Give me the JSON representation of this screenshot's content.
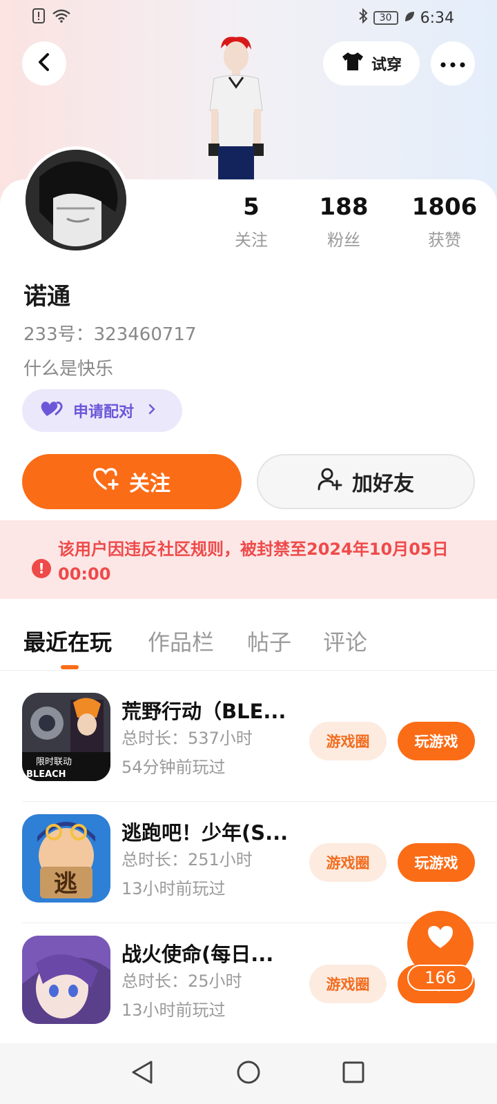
{
  "status_bar": {
    "time": "6:34",
    "battery": "30"
  },
  "header": {
    "try_on_label": "试穿"
  },
  "profile": {
    "stats": [
      {
        "value": "5",
        "label": "关注"
      },
      {
        "value": "188",
        "label": "粉丝"
      },
      {
        "value": "1806",
        "label": "获赞"
      }
    ],
    "username": "诺通",
    "user_id": "233号：323460717",
    "bio": "什么是快乐",
    "pair_label": "申请配对"
  },
  "actions": {
    "follow_label": "关注",
    "add_friend_label": "加好友"
  },
  "ban_notice": {
    "text": "该用户因违反社区规则，被封禁至2024年10月05日 00:00"
  },
  "tabs": [
    {
      "label": "最近在玩",
      "active": true
    },
    {
      "label": "作品栏",
      "active": false
    },
    {
      "label": "帖子",
      "active": false
    },
    {
      "label": "评论",
      "active": false
    }
  ],
  "games": [
    {
      "name": "荒野行动（BLE...",
      "duration": "总时长：537小时",
      "last_played": "54分钟前玩过",
      "circle_label": "游戏圈",
      "play_label": "玩游戏",
      "icon_text_1": "限时联动",
      "icon_text_2": "BLEACH"
    },
    {
      "name": "逃跑吧！少年(S...",
      "duration": "总时长：251小时",
      "last_played": "13小时前玩过",
      "circle_label": "游戏圈",
      "play_label": "玩游戏",
      "icon_text_1": "逃"
    },
    {
      "name": "战火使命(每日...",
      "duration": "总时长：25小时",
      "last_played": "13小时前玩过",
      "circle_label": "游戏圈",
      "play_label": "玩游戏"
    }
  ],
  "like_fab": {
    "count": "166"
  },
  "colors": {
    "accent": "#fb6c16",
    "ban_red": "#ee4a4a",
    "pair_purple": "#6b57d8"
  }
}
